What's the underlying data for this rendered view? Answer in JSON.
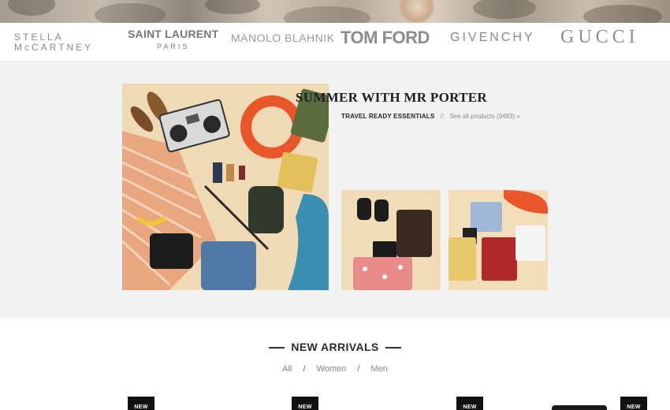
{
  "brands": {
    "stella_line1": "STELLA",
    "stella_line2": "McCARTNEY",
    "saint_laurent": "SAINT LAURENT",
    "saint_laurent_sub": "PARIS",
    "manolo": "MANOLO BLAHNIK",
    "tom_ford": "TOM FORD",
    "givenchy": "GIVENCHY",
    "gucci": "GUCCI"
  },
  "feature": {
    "title": "SUMMER WITH MR PORTER",
    "category_link": "TRAVEL READY ESSENTIALS",
    "separator": "//",
    "see_all": "See all products (9483) »"
  },
  "arrivals": {
    "title": "NEW ARRIVALS",
    "filters": [
      "All",
      "Women",
      "Men"
    ],
    "badge": "NEW"
  },
  "colors": {
    "feature_bg": "#f2f2f2",
    "image_bg": "#f0d9b5",
    "badge_bg": "#111111"
  }
}
